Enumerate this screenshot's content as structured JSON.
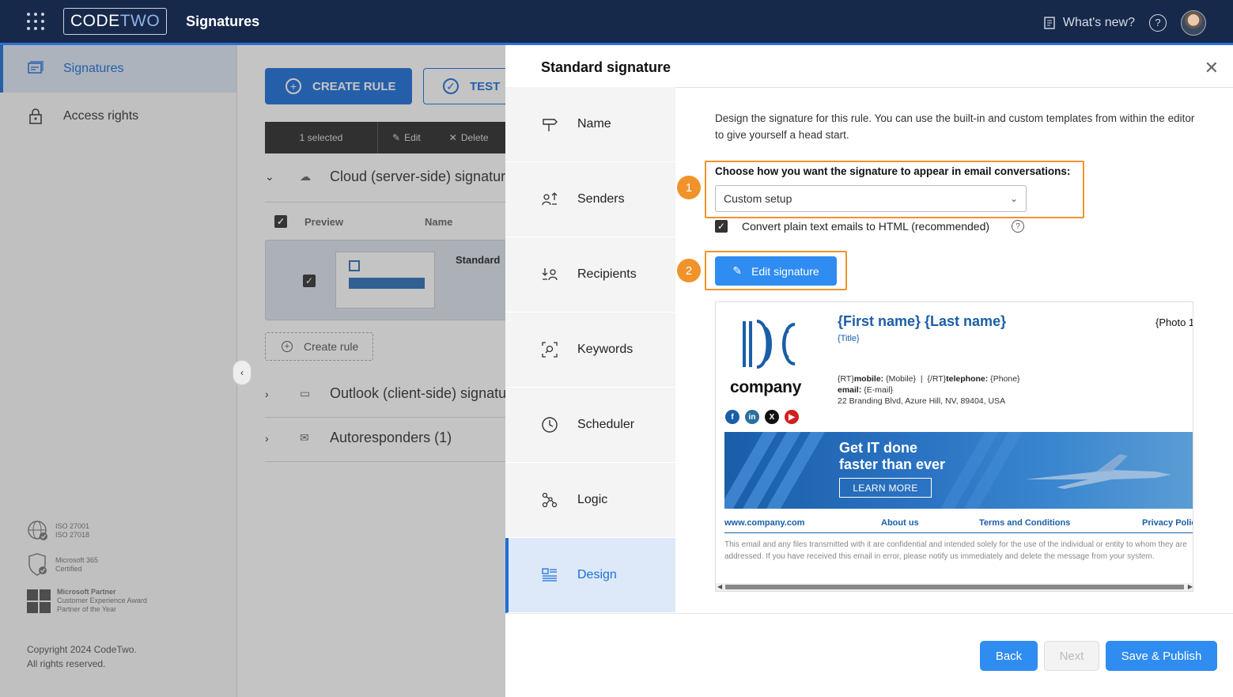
{
  "topbar": {
    "logo_code": "CODE",
    "logo_two": "TWO",
    "app_title": "Signatures",
    "whats_new": "What's new?",
    "help": "?"
  },
  "sidebar": {
    "items": [
      {
        "label": "Signatures",
        "icon": "signatures-icon",
        "active": true
      },
      {
        "label": "Access rights",
        "icon": "lock-icon",
        "active": false
      }
    ],
    "certs": [
      {
        "line1": "ISO 27001",
        "line2": "ISO 27018",
        "line3": ""
      },
      {
        "line1": "Microsoft 365",
        "line2": "Certified",
        "line3": ""
      },
      {
        "line1": "Microsoft Partner",
        "line2": "Customer Experience Award",
        "line3": "Partner of the Year"
      }
    ],
    "copyright_line1": "Copyright 2024 CodeTwo.",
    "copyright_line2": "All rights reserved."
  },
  "main": {
    "create_rule": "CREATE RULE",
    "test": "TEST",
    "toolbar": {
      "selected": "1 selected",
      "edit": "Edit",
      "delete": "Delete"
    },
    "groups": [
      {
        "label": "Cloud (server-side) signatures",
        "expanded": true
      },
      {
        "label": "Outlook (client-side) signatures",
        "expanded": false
      },
      {
        "label": "Autoresponders (1)",
        "expanded": false
      }
    ],
    "table_headers": {
      "preview": "Preview",
      "name": "Name"
    },
    "row": {
      "name": "Standard"
    },
    "create_rule_link": "Create rule"
  },
  "panel": {
    "title": "Standard signature",
    "steps": [
      {
        "label": "Name",
        "icon": "signpost-icon"
      },
      {
        "label": "Senders",
        "icon": "senders-icon"
      },
      {
        "label": "Recipients",
        "icon": "recipients-icon"
      },
      {
        "label": "Keywords",
        "icon": "keywords-icon"
      },
      {
        "label": "Scheduler",
        "icon": "clock-icon"
      },
      {
        "label": "Logic",
        "icon": "logic-icon"
      },
      {
        "label": "Design",
        "icon": "design-icon",
        "active": true
      }
    ],
    "description": "Design the signature for this rule. You can use the built-in and custom templates from within the editor to give yourself a head start.",
    "badge1": "1",
    "badge2": "2",
    "choose_label": "Choose how you want the signature to appear in email conversations:",
    "select_value": "Custom setup",
    "convert_label": "Convert plain text emails to HTML (recommended)",
    "edit_signature": "Edit signature",
    "preview": {
      "company": "company",
      "name": "{First name} {Last name}",
      "title": "{Title}",
      "photo": "{Photo 1",
      "contact_prefix1": "{RT}",
      "mobile_label": "mobile:",
      "mobile_value": " {Mobile}  |  {/RT}",
      "telephone_label": "telephone:",
      "telephone_value": " {Phone}",
      "email_label": "email:",
      "email_value": " {E-mail}",
      "address": "22 Branding Blvd, Azure Hill, NV, 89404, USA",
      "banner_line1": "Get IT done",
      "banner_line2": "faster than ever",
      "learn_more": "LEARN MORE",
      "links": [
        "www.company.com",
        "About us",
        "Terms and Conditions",
        "Privacy Polic"
      ],
      "disclaimer": "This email and any files transmitted with it are confidential and intended solely for the use of the individual or entity to whom they are addressed. If you have received this email in error, please notify us immediately and delete the message from your system."
    },
    "buttons": {
      "back": "Back",
      "next": "Next",
      "save": "Save & Publish"
    }
  },
  "colors": {
    "accent": "#1e6fd9",
    "topbar": "#17294a",
    "highlight": "#f0932b",
    "brand_blue": "#1a5ea8"
  }
}
